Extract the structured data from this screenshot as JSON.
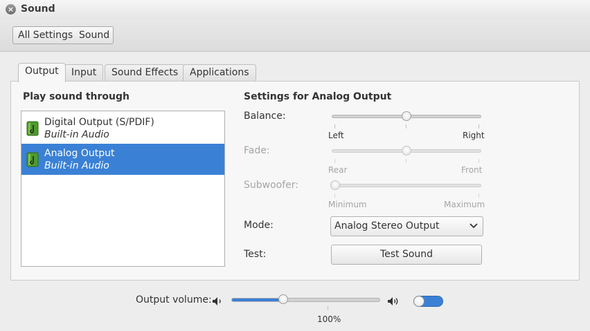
{
  "window": {
    "title": "Sound",
    "close_glyph": "×"
  },
  "breadcrumb": {
    "items": [
      "All Settings",
      "Sound"
    ]
  },
  "tabs": [
    {
      "label": "Output",
      "active": true
    },
    {
      "label": "Input",
      "active": false
    },
    {
      "label": "Sound Effects",
      "active": false
    },
    {
      "label": "Applications",
      "active": false
    }
  ],
  "output": {
    "list_heading": "Play sound through",
    "devices": [
      {
        "name": "Digital Output (S/PDIF)",
        "subtitle": "Built-in Audio",
        "icon": "audio-card-icon",
        "selected": false
      },
      {
        "name": "Analog Output",
        "subtitle": "Built-in Audio",
        "icon": "audio-card-icon",
        "selected": true
      }
    ],
    "settings_heading": "Settings for Analog Output",
    "balance": {
      "label": "Balance:",
      "left": "Left",
      "right": "Right",
      "value": 0.5
    },
    "fade": {
      "label": "Fade:",
      "left": "Rear",
      "right": "Front",
      "value": 0.5,
      "enabled": false
    },
    "subwoofer": {
      "label": "Subwoofer:",
      "left": "Minimum",
      "right": "Maximum",
      "value": 0.0,
      "enabled": false
    },
    "mode": {
      "label": "Mode:",
      "value": "Analog Stereo Output"
    },
    "test": {
      "label": "Test:",
      "button": "Test Sound"
    }
  },
  "volume": {
    "label": "Output volume:",
    "level_fraction": 0.35,
    "mark_label": "100%",
    "muted": false,
    "low_icon": "speaker-low-icon",
    "high_icon": "speaker-high-icon"
  },
  "colors": {
    "accent": "#3a81d6",
    "background": "#ededed"
  }
}
